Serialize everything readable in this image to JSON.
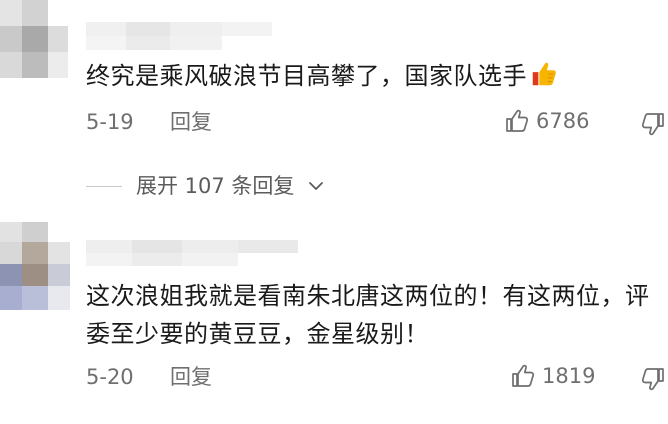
{
  "comments": [
    {
      "text": "终究是乘风破浪节目高攀了，国家队选手",
      "emoji_icon": "thumbs-up-icon",
      "date": "5-19",
      "reply_label": "回复",
      "likes": "6786"
    },
    {
      "text": "这次浪姐我就是看南朱北唐这两位的！有这两位，评委至少要的黄豆豆，金星级别！",
      "date": "5-20",
      "reply_label": "回复",
      "likes": "1819"
    }
  ],
  "expand_replies": {
    "label": "展开 107 条回复",
    "icon": "chevron-down-icon"
  },
  "colors": {
    "text": "#1a1a1a",
    "meta": "#6f6f6f",
    "emoji_yellow": "#f7b500",
    "emoji_red": "#e03a1e"
  }
}
